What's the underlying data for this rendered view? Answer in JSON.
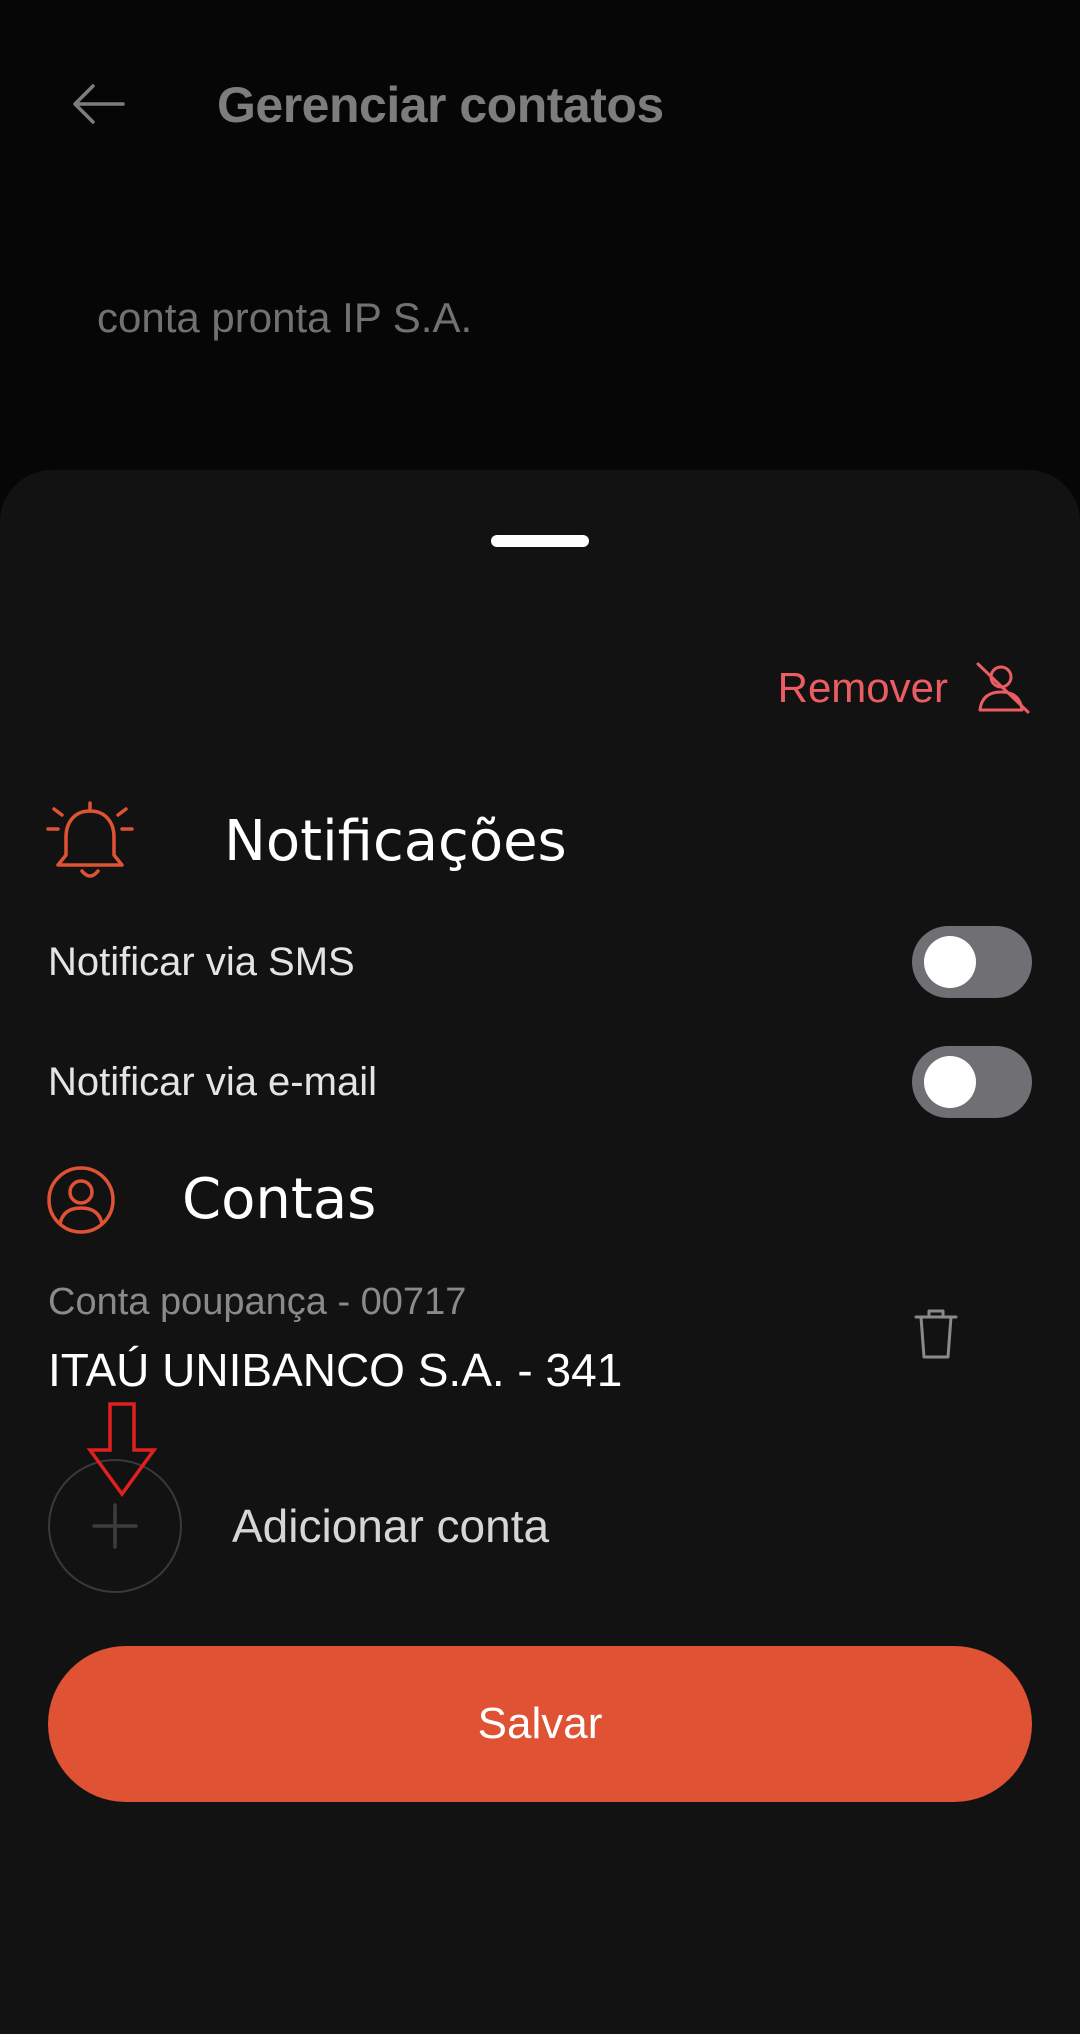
{
  "header": {
    "title": "Gerenciar contatos",
    "back_icon": "arrow-left-icon"
  },
  "contact": {
    "name": "conta pronta IP S.A."
  },
  "sheet": {
    "remove": {
      "label": "Remover",
      "icon": "user-remove-icon",
      "color": "#ec5c63"
    },
    "notifications": {
      "title": "Notificações",
      "icon": "bell-icon",
      "options": [
        {
          "label": "Notificar via SMS",
          "enabled": false
        },
        {
          "label": "Notificar via e-mail",
          "enabled": false
        }
      ]
    },
    "accounts": {
      "title": "Contas",
      "icon": "user-circle-icon",
      "items": [
        {
          "type": "Conta poupança - 00717",
          "bank": "ITAÚ UNIBANCO S.A. - 341"
        }
      ],
      "add_label": "Adicionar conta"
    },
    "save_label": "Salvar"
  },
  "colors": {
    "accent": "#df5233",
    "remove": "#ec5c63",
    "background": "#121212",
    "annotation_arrow": "#e0201c"
  }
}
